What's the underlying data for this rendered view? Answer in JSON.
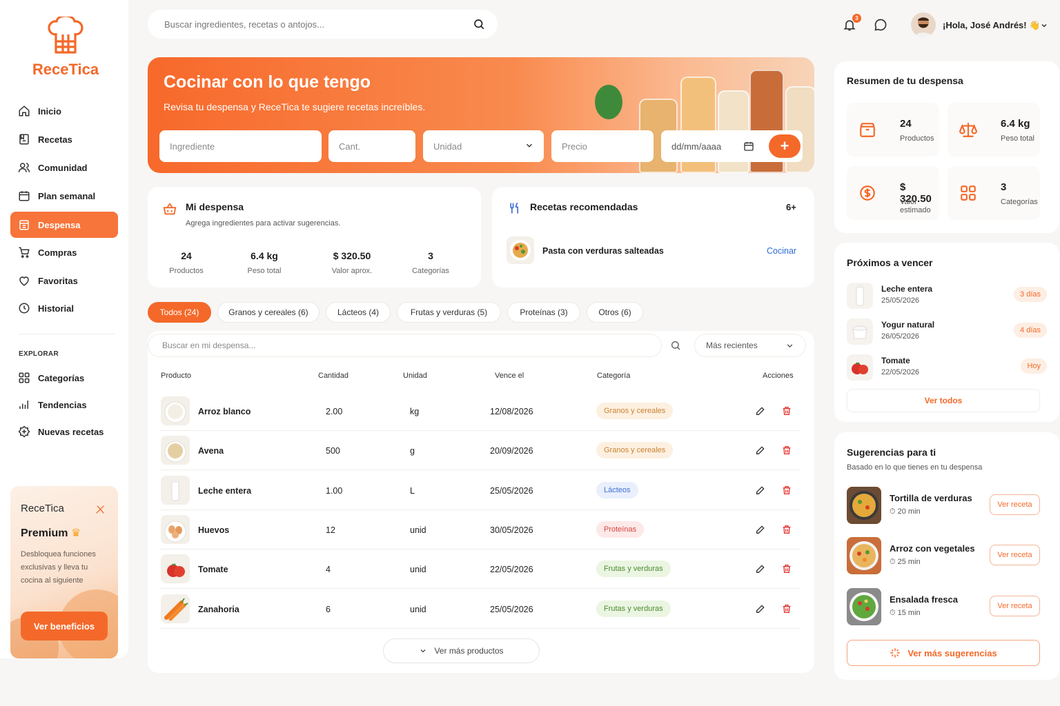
{
  "brand": {
    "name": "ReceTica"
  },
  "colors": {
    "accent": "#f4692a"
  },
  "sidebar": {
    "items": [
      {
        "label": "Inicio",
        "icon": "home-icon"
      },
      {
        "label": "Recetas",
        "icon": "book-icon"
      },
      {
        "label": "Comunidad",
        "icon": "users-icon"
      },
      {
        "label": "Plan semanal",
        "icon": "calendar-icon"
      },
      {
        "label": "Despensa",
        "icon": "pantry-icon",
        "active": true
      },
      {
        "label": "Compras",
        "icon": "cart-icon"
      },
      {
        "label": "Favoritas",
        "icon": "heart-icon"
      },
      {
        "label": "Historial",
        "icon": "clock-icon"
      }
    ],
    "explore_label": "EXPLORAR",
    "explore": [
      {
        "label": "Categorías",
        "icon": "grid-icon"
      },
      {
        "label": "Tendencias",
        "icon": "trend-icon"
      },
      {
        "label": "Nuevas recetas",
        "icon": "new-recipe-icon"
      }
    ],
    "premium": {
      "title": "ReceTica",
      "subtitle": "Premium",
      "text": "Desbloquea funciones exclusivas y lleva tu cocina al siguiente",
      "button": "Ver beneficios"
    }
  },
  "topbar": {
    "search_placeholder": "Buscar ingredientes, recetas o antojos...",
    "notifications_count": "3",
    "greeting": "¡Hola, José Andrés! 👋"
  },
  "hero": {
    "title": "Cocinar con lo que tengo",
    "subtitle": "Revisa tu despensa y ReceTica te sugiere recetas increíbles.",
    "fields": {
      "ingredient": "Ingrediente",
      "quantity": "Cant.",
      "unit": "Unidad",
      "price": "Precio",
      "date": "dd/mm/aaaa"
    },
    "add_label": "+"
  },
  "pantry": {
    "title": "Mi despensa",
    "subtitle": "Agrega ingredientes para activar sugerencias.",
    "stats": [
      {
        "value": "24",
        "label": "Productos"
      },
      {
        "value": "6.4 kg",
        "label": "Peso total"
      },
      {
        "value": "$ 320.50",
        "label": "Valor aprox."
      },
      {
        "value": "3",
        "label": "Categorías"
      }
    ]
  },
  "recommended": {
    "title": "Recetas recomendadas",
    "count": "6+",
    "item": "Pasta con verduras salteadas",
    "action": "Cocinar"
  },
  "tabs": [
    {
      "label": "Todos (24)",
      "active": true
    },
    {
      "label": "Granos y cereales (6)"
    },
    {
      "label": "Lácteos (4)"
    },
    {
      "label": "Frutas y verduras (5)"
    },
    {
      "label": "Proteínas (3)"
    },
    {
      "label": "Otros (6)"
    }
  ],
  "table": {
    "search_placeholder": "Buscar en mi despensa...",
    "sort": "Más recientes",
    "headers": [
      "Producto",
      "Cantidad",
      "Unidad",
      "Vence el",
      "Categoría",
      "Acciones"
    ],
    "rows": [
      {
        "name": "Arroz blanco",
        "qty": "2.00",
        "unit": "kg",
        "exp": "12/08/2026",
        "cat": "Granos y cereales",
        "cat_color": "#c9822f",
        "cat_bg": "#fdf0e1"
      },
      {
        "name": "Avena",
        "qty": "500",
        "unit": "g",
        "exp": "20/09/2026",
        "cat": "Granos y cereales",
        "cat_color": "#c9822f",
        "cat_bg": "#fdf0e1"
      },
      {
        "name": "Leche entera",
        "qty": "1.00",
        "unit": "L",
        "exp": "25/05/2026",
        "cat": "Lácteos",
        "cat_color": "#3f6fd1",
        "cat_bg": "#e9effd"
      },
      {
        "name": "Huevos",
        "qty": "12",
        "unit": "unid",
        "exp": "30/05/2026",
        "cat": "Proteínas",
        "cat_color": "#d9443f",
        "cat_bg": "#fde9e8"
      },
      {
        "name": "Tomate",
        "qty": "4",
        "unit": "unid",
        "exp": "22/05/2026",
        "cat": "Frutas y verduras",
        "cat_color": "#4c8a2f",
        "cat_bg": "#eaf5e2"
      },
      {
        "name": "Zanahoria",
        "qty": "6",
        "unit": "unid",
        "exp": "25/05/2026",
        "cat": "Frutas y verduras",
        "cat_color": "#4c8a2f",
        "cat_bg": "#eaf5e2"
      }
    ],
    "more": "Ver más productos"
  },
  "summary": {
    "title": "Resumen de tu despensa",
    "items": [
      {
        "value": "24",
        "label": "Productos",
        "icon": "box-icon"
      },
      {
        "value": "6.4 kg",
        "label": "Peso total",
        "icon": "scale-icon"
      },
      {
        "value": "$ 320.50",
        "label": "Valor estimado",
        "icon": "dollar-icon"
      },
      {
        "value": "3",
        "label": "Categorías",
        "icon": "grid-icon"
      }
    ]
  },
  "expiring": {
    "title": "Próximos a vencer",
    "items": [
      {
        "name": "Leche entera",
        "date": "25/05/2026",
        "badge": "3 días"
      },
      {
        "name": "Yogur natural",
        "date": "26/05/2026",
        "badge": "4 días"
      },
      {
        "name": "Tomate",
        "date": "22/05/2026",
        "badge": "Hoy"
      }
    ],
    "see_all": "Ver todos"
  },
  "suggestions": {
    "title": "Sugerencias para ti",
    "subtitle": "Basado en lo que tienes en tu despensa",
    "items": [
      {
        "name": "Tortilla de verduras",
        "time": "20 min",
        "action": "Ver receta"
      },
      {
        "name": "Arroz con vegetales",
        "time": "25 min",
        "action": "Ver receta"
      },
      {
        "name": "Ensalada fresca",
        "time": "15 min",
        "action": "Ver receta"
      }
    ],
    "more": "Ver más sugerencias"
  }
}
